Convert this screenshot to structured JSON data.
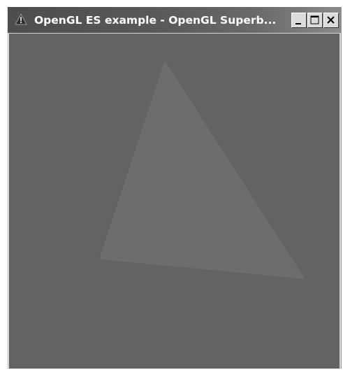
{
  "window": {
    "title": "OpenGL ES example - OpenGL Superb..."
  },
  "icons": {
    "app": "warning-triangle-icon",
    "minimize": "minimize-icon",
    "maximize": "maximize-icon",
    "close": "close-icon"
  },
  "colors": {
    "titlebar": "#4d4d4d",
    "client_background": "#636363",
    "triangle_fill": "#6d6d6d"
  }
}
